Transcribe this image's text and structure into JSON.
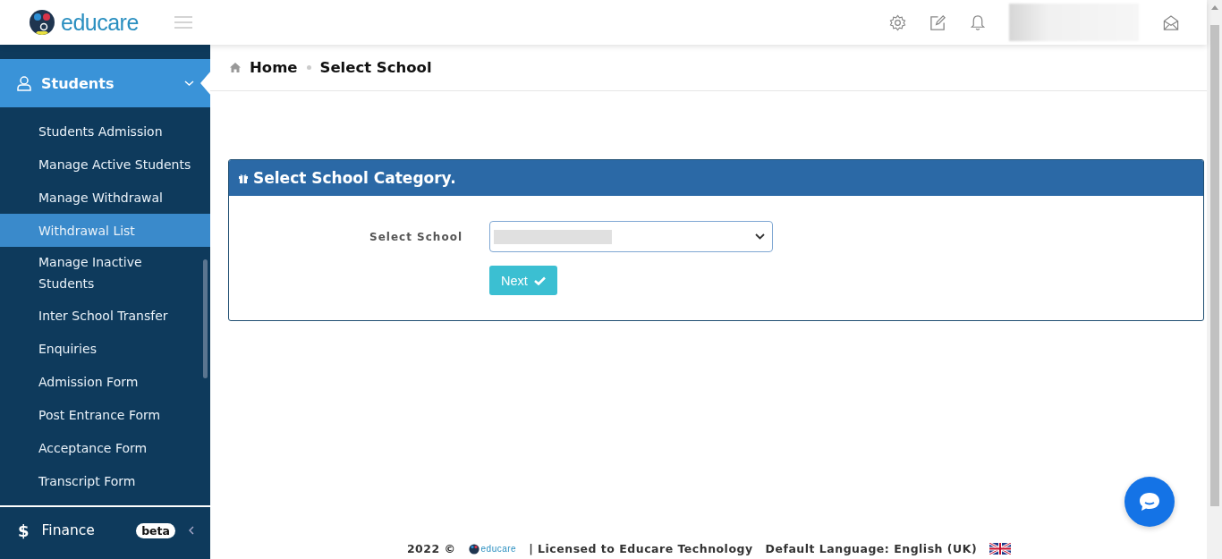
{
  "header": {
    "logo_text": "educare"
  },
  "sidebar": {
    "section": {
      "label": "Students",
      "expanded": true,
      "selected": true
    },
    "items": [
      {
        "label": "Students Admission",
        "selected": false
      },
      {
        "label": "Manage Active Students",
        "selected": false
      },
      {
        "label": "Manage Withdrawal",
        "selected": false
      },
      {
        "label": "Withdrawal List",
        "selected": true
      },
      {
        "label": "Manage Inactive Students",
        "selected": false
      },
      {
        "label": "Inter School Transfer",
        "selected": false
      },
      {
        "label": "Enquiries",
        "selected": false
      },
      {
        "label": "Admission Form",
        "selected": false
      },
      {
        "label": "Post Entrance Form",
        "selected": false
      },
      {
        "label": "Acceptance Form",
        "selected": false
      },
      {
        "label": "Transcript Form",
        "selected": false
      }
    ],
    "next_section": {
      "icon": "$",
      "label": "Finance",
      "badge": "beta"
    }
  },
  "breadcrumb": [
    "Home",
    "Select School"
  ],
  "card": {
    "title": "Select School Category.",
    "field_label": "Select School",
    "button": "Next"
  },
  "footer": {
    "year": "2022 ©",
    "logo_text": "educare",
    "license": "| Licensed to Educare Technology",
    "language": "Default Language: English (UK)"
  }
}
